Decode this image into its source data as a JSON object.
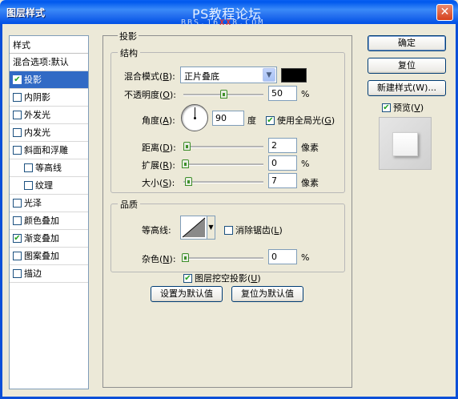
{
  "window": {
    "title": "图层样式",
    "watermark": "PS教程论坛",
    "watermark_url_left": "BBS.16",
    "watermark_url_xx": "XX",
    "watermark_url_right": "8.COM",
    "close_glyph": "✕"
  },
  "style_list": {
    "header": "样式",
    "items": [
      {
        "label": "混合选项:默认",
        "checkbox": false,
        "checked": false,
        "indent": false,
        "selected": false
      },
      {
        "label": "投影",
        "checkbox": true,
        "checked": true,
        "indent": false,
        "selected": true
      },
      {
        "label": "内阴影",
        "checkbox": true,
        "checked": false,
        "indent": false,
        "selected": false
      },
      {
        "label": "外发光",
        "checkbox": true,
        "checked": false,
        "indent": false,
        "selected": false
      },
      {
        "label": "内发光",
        "checkbox": true,
        "checked": false,
        "indent": false,
        "selected": false
      },
      {
        "label": "斜面和浮雕",
        "checkbox": true,
        "checked": false,
        "indent": false,
        "selected": false
      },
      {
        "label": "等高线",
        "checkbox": true,
        "checked": false,
        "indent": true,
        "selected": false
      },
      {
        "label": "纹理",
        "checkbox": true,
        "checked": false,
        "indent": true,
        "selected": false
      },
      {
        "label": "光泽",
        "checkbox": true,
        "checked": false,
        "indent": false,
        "selected": false
      },
      {
        "label": "颜色叠加",
        "checkbox": true,
        "checked": false,
        "indent": false,
        "selected": false
      },
      {
        "label": "渐变叠加",
        "checkbox": true,
        "checked": true,
        "indent": false,
        "selected": false
      },
      {
        "label": "图案叠加",
        "checkbox": true,
        "checked": false,
        "indent": false,
        "selected": false
      },
      {
        "label": "描边",
        "checkbox": true,
        "checked": false,
        "indent": false,
        "selected": false
      }
    ]
  },
  "drop_shadow": {
    "section_title": "投影",
    "structure": {
      "title": "结构",
      "blend_mode_label": "混合模式(",
      "blend_mode_key": "B",
      "blend_mode_value": "正片叠底",
      "shadow_color": "#000000",
      "opacity_label": "不透明度(",
      "opacity_key": "O",
      "opacity_value": "50",
      "opacity_fraction": 0.5,
      "angle_label": "角度(",
      "angle_key": "A",
      "angle_value": "90",
      "angle_unit": "度",
      "global_light_label": "使用全局光(",
      "global_light_key": "G",
      "global_light_checked": true,
      "distance_label": "距离(",
      "distance_key": "D",
      "distance_value": "2",
      "distance_unit": "像素",
      "spread_label": "扩展(",
      "spread_key": "R",
      "spread_value": "0",
      "size_label": "大小(",
      "size_key": "S",
      "size_value": "7",
      "size_unit": "像素",
      "percent_unit": "%",
      "close_paren": "):"
    },
    "quality": {
      "title": "品质",
      "contour_label": "等高线:",
      "anti_alias_label": "消除锯齿(",
      "anti_alias_key": "L",
      "anti_alias_checked": false,
      "noise_label": "杂色(",
      "noise_key": "N",
      "noise_value": "0"
    },
    "knockout_label": "图层挖空投影(",
    "knockout_key": "U",
    "knockout_checked": true,
    "make_default_label": "设置为默认值",
    "reset_default_label": "复位为默认值"
  },
  "right_buttons": {
    "ok": "确定",
    "reset": "复位",
    "new_style": "新建样式(W)...",
    "preview_label": "预览(",
    "preview_key": "V",
    "preview_checked": true
  }
}
